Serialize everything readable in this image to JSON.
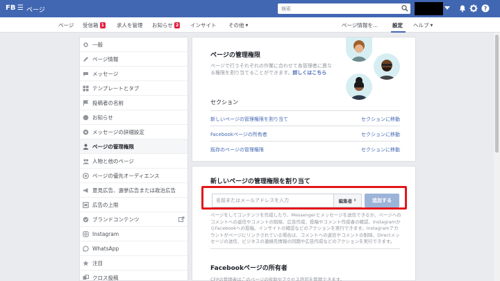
{
  "topbar": {
    "logo": "FB",
    "menu_icon": "hamburger-icon",
    "page_title": "ページ",
    "search_placeholder": "検索",
    "icons": [
      "caret-down-icon",
      "bell-icon",
      "gear-icon",
      "help-icon"
    ]
  },
  "tabs": {
    "pages": "ページ",
    "inbox": "受信箱",
    "inbox_count": "1",
    "jobs": "求人を管理",
    "notifications": "お知らせ",
    "notifications_count": "2",
    "insights": "インサイト",
    "more": "その他",
    "edit_page_info": "ページ情報を...",
    "settings": "設定",
    "help": "ヘルプ"
  },
  "sidebar": {
    "items": [
      {
        "label": "一般",
        "icon": "gear-icon"
      },
      {
        "label": "ページ情報",
        "icon": "pencil-icon"
      },
      {
        "label": "メッセージ",
        "icon": "chat-icon"
      },
      {
        "label": "テンプレートとタブ",
        "icon": "grid-icon"
      },
      {
        "label": "投稿者の名前",
        "icon": "flag-icon"
      },
      {
        "label": "お知らせ",
        "icon": "globe-icon"
      },
      {
        "label": "メッセージの詳細設定",
        "icon": "chat-gear-icon"
      },
      {
        "label": "ページの管理権限",
        "icon": "person-icon"
      },
      {
        "label": "人物と他のページ",
        "icon": "people-icon"
      },
      {
        "label": "ページの優先オーディエンス",
        "icon": "audience-icon"
      },
      {
        "label": "意見広告、選挙広告または政治広告",
        "icon": "megaphone-icon"
      },
      {
        "label": "広告の上限",
        "icon": "ad-limit-icon"
      },
      {
        "label": "ブランドコンテンツ",
        "icon": "brand-icon"
      },
      {
        "label": "Instagram",
        "icon": "instagram-icon"
      },
      {
        "label": "WhatsApp",
        "icon": "whatsapp-icon"
      },
      {
        "label": "注目",
        "icon": "star-icon"
      },
      {
        "label": "クロス投稿",
        "icon": "crosspost-icon"
      }
    ],
    "active_index": 7
  },
  "roles_card": {
    "title": "ページの管理権限",
    "description": "ページで行うそれぞれの作業に合わせて各管理者に異なる権限を割り当てることができます。",
    "learn_more": "詳しくはこちら",
    "section_heading": "セクション",
    "sections": [
      {
        "label": "新しいページの管理権限を割り当て",
        "link": "セクションに移動"
      },
      {
        "label": "Facebookページの所有者",
        "link": "セクションに移動"
      },
      {
        "label": "既存のページの管理権限",
        "link": "セクションに移動"
      }
    ]
  },
  "assign_card": {
    "title": "新しいページの管理権限を割り当て",
    "input_placeholder": "名前またはメールアドレスを入力",
    "role_select": "編集者",
    "add_button": "追加する",
    "description": "ページをしてコンテンツを作成したり、Messengerとメッセージを送信できるか、ページへのコメントへの返信やコメントの削除、広告作成、投稿やコメント作成者の確認、InstagramからFacebookへの投稿、インサイトの確認などのアクションを実行できます。Instagramアカウントがページにリンクされている場合は、コメントへの返信やコメントの削除、Directメッセージの送信、ビジネスの連絡先情報の同期や広告作成などのアクションを実行できます。",
    "owner_title": "Facebookページの所有者",
    "owner_desc": "CFPの管理者はこのページの役割やアクセス許可を管理できます。"
  },
  "colors": {
    "brand": "#4267b2",
    "highlight": "#e3151a",
    "badge": "#e41e3f"
  }
}
